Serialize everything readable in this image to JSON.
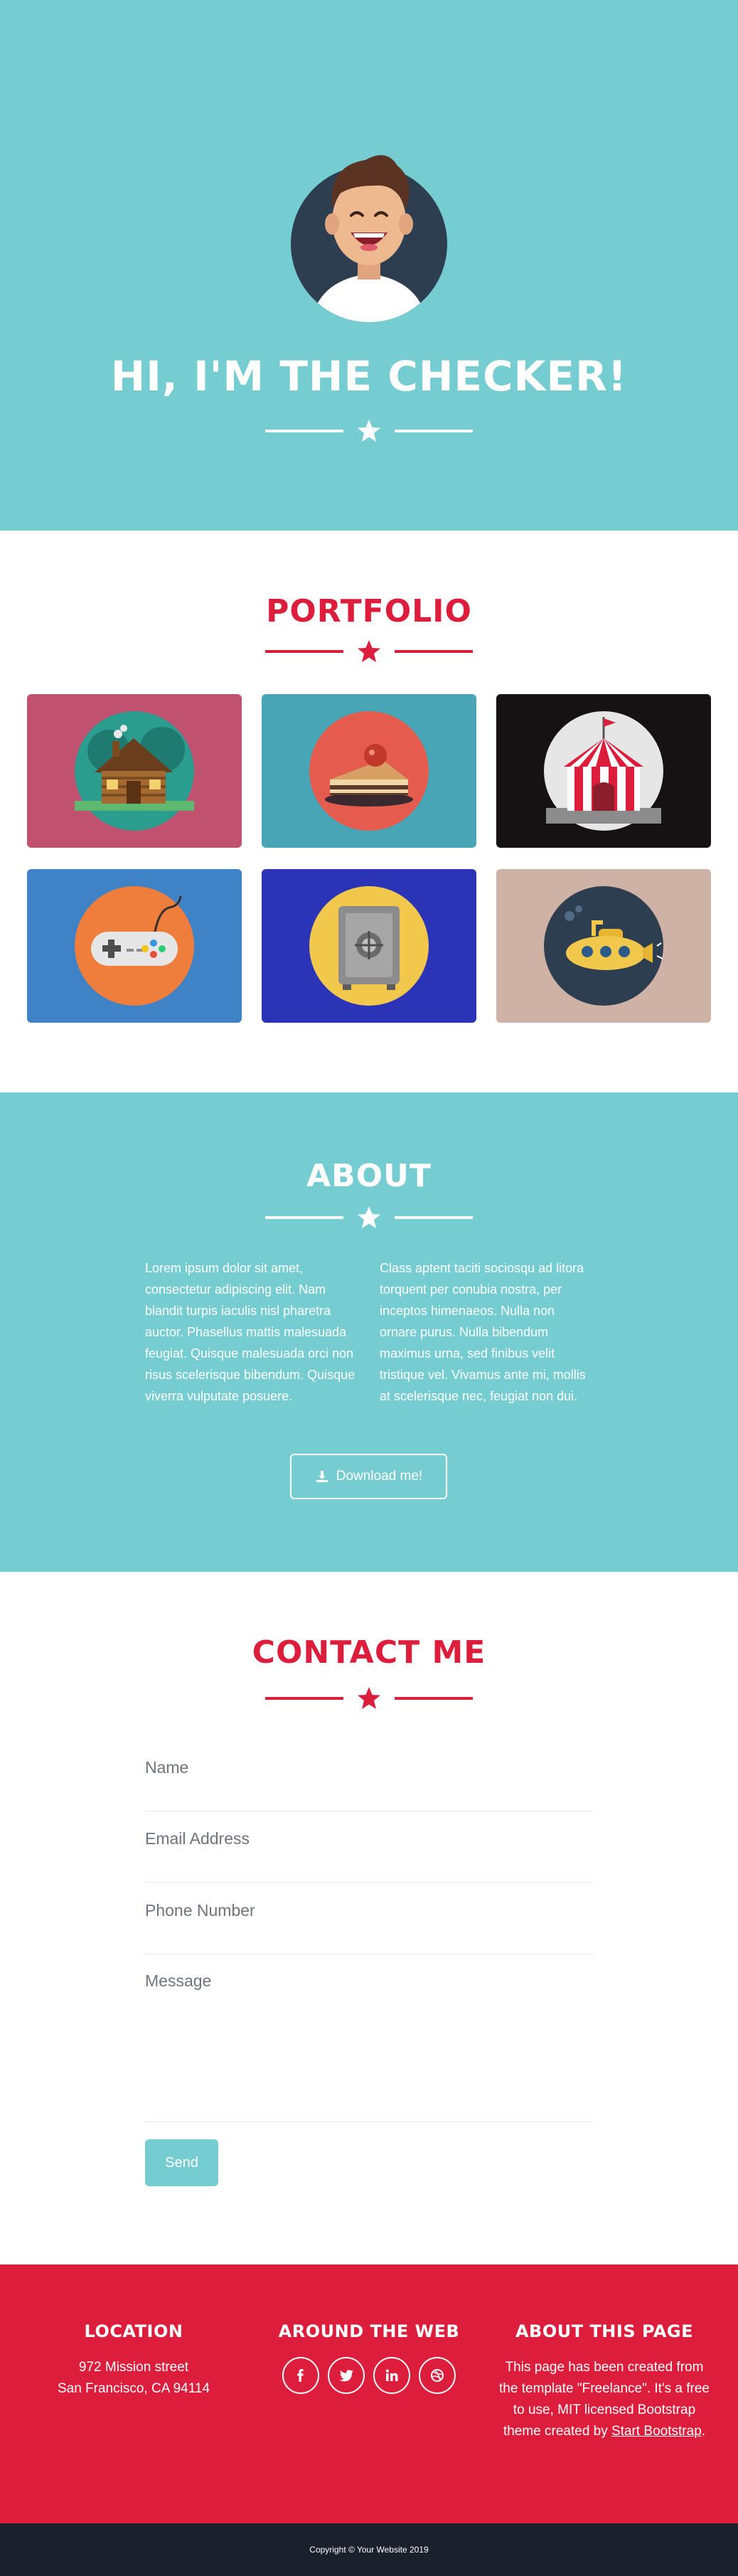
{
  "colors": {
    "primary": "#76cdd1",
    "accent": "#dc1e3c",
    "dark": "#1a202c",
    "white": "#ffffff"
  },
  "masthead": {
    "title": "HI, I'M THE CHECKER!",
    "avatar_icon": "smiling-man-avatar-icon",
    "divider_icon": "star-icon"
  },
  "portfolio": {
    "heading": "PORTFOLIO",
    "items": [
      {
        "icon": "log-cabin-icon",
        "bg": "#c1526f"
      },
      {
        "icon": "cake-slice-icon",
        "bg": "#47a5b6"
      },
      {
        "icon": "circus-tent-icon",
        "bg": "#161213"
      },
      {
        "icon": "game-controller-icon",
        "bg": "#3f82c6"
      },
      {
        "icon": "safe-icon",
        "bg": "#2b34b7"
      },
      {
        "icon": "submarine-icon",
        "bg": "#cfb2a6"
      }
    ]
  },
  "about": {
    "heading": "ABOUT",
    "left_text": "Lorem ipsum dolor sit amet, consectetur adipiscing elit. Nam blandit turpis iaculis nisl pharetra auctor. Phasellus mattis malesuada feugiat. Quisque malesuada orci non risus scelerisque bibendum. Quisque viverra vulputate posuere.",
    "right_text": "Class aptent taciti sociosqu ad litora torquent per conubia nostra, per inceptos himenaeos. Nulla non ornare purus. Nulla bibendum maximus urna, sed finibus velit tristique vel. Vivamus ante mi, mollis at scelerisque nec, feugiat non dui.",
    "download_label": "Download me!",
    "download_icon": "download-icon"
  },
  "contact": {
    "heading": "CONTACT ME",
    "name_placeholder": "Name",
    "email_placeholder": "Email Address",
    "phone_placeholder": "Phone Number",
    "message_placeholder": "Message",
    "send_label": "Send"
  },
  "footer": {
    "location_title": "LOCATION",
    "address_line1": "972 Mission street",
    "address_line2": "San Francisco, CA 94114",
    "web_title": "AROUND THE WEB",
    "social_icons": [
      "facebook-icon",
      "twitter-icon",
      "linkedin-icon",
      "dribbble-icon"
    ],
    "about_title": "ABOUT THIS PAGE",
    "about_text": "This page has been created from the template \"Freelance\". It's a free to use, MIT licensed Bootstrap theme created by",
    "about_link": "Start Bootstrap",
    "about_end": "."
  },
  "copyright": "Copyright © Your Website 2019"
}
